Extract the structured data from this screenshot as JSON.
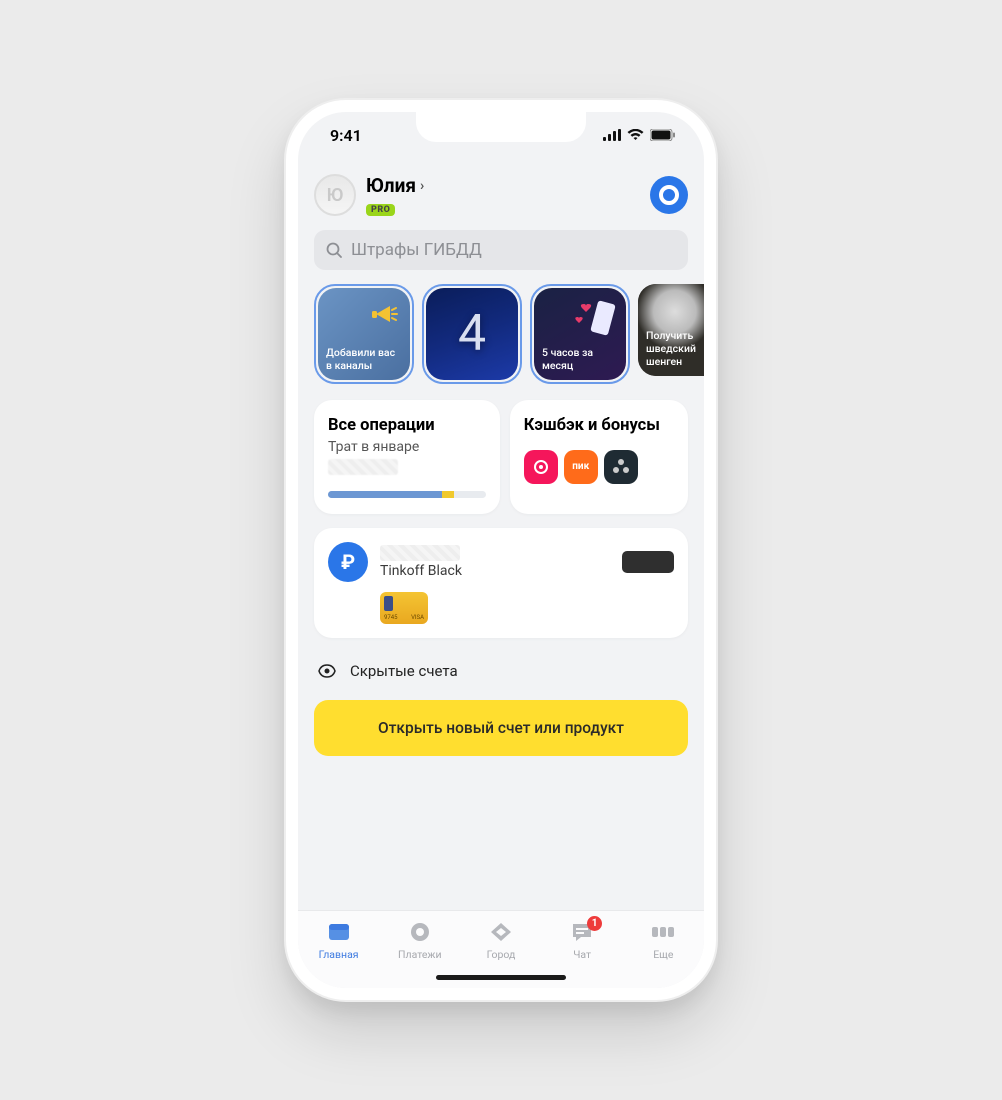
{
  "status": {
    "time": "9:41"
  },
  "header": {
    "avatar_initial": "Ю",
    "username": "Юлия",
    "pro_badge": "PRO"
  },
  "search": {
    "placeholder": "Штрафы ГИБДД"
  },
  "stories": [
    {
      "text": "Добавили вас в каналы"
    },
    {
      "big": "4"
    },
    {
      "text": "5 часов за месяц"
    },
    {
      "text": "Получить шведский шенген"
    }
  ],
  "operations": {
    "title": "Все операции",
    "subtitle": "Трат в январе"
  },
  "cashback": {
    "title": "Кэшбэк и бонусы",
    "partners": [
      {
        "label": ""
      },
      {
        "label": "пик"
      },
      {
        "label": ""
      }
    ]
  },
  "account": {
    "name": "Tinkoff Black",
    "card_last": "9745",
    "card_brand": "VISA"
  },
  "hidden_accounts": {
    "label": "Скрытые счета"
  },
  "cta": {
    "label": "Открыть новый счет или продукт"
  },
  "tabs": [
    {
      "label": "Главная"
    },
    {
      "label": "Платежи"
    },
    {
      "label": "Город"
    },
    {
      "label": "Чат",
      "badge": "1"
    },
    {
      "label": "Еще"
    }
  ]
}
